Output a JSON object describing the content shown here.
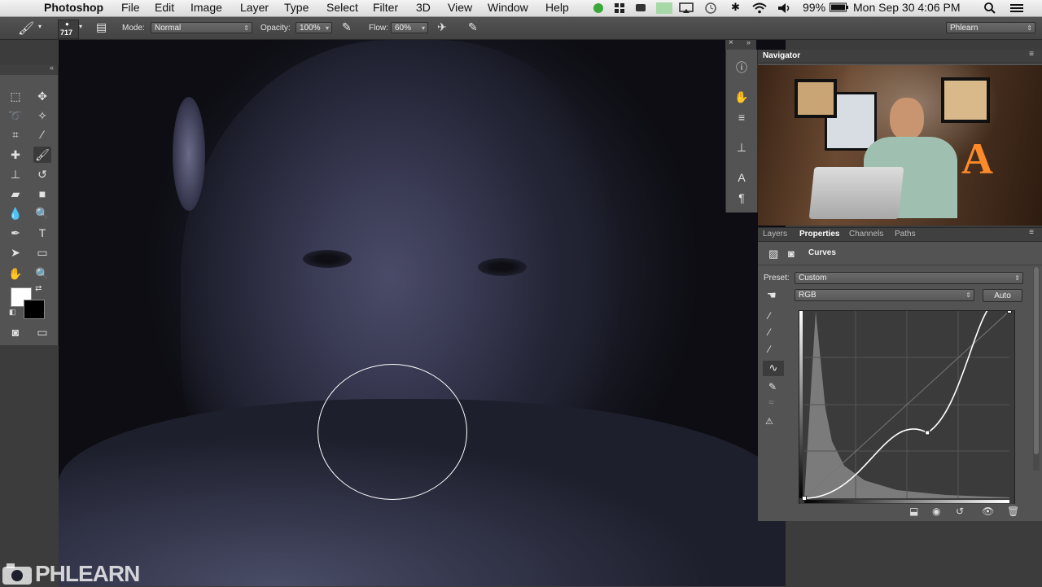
{
  "menubar": {
    "app_name": "Photoshop",
    "menus": [
      "File",
      "Edit",
      "Image",
      "Layer",
      "Type",
      "Select",
      "Filter",
      "3D",
      "View",
      "Window",
      "Help"
    ],
    "battery": "99%",
    "clock": "Mon Sep 30  4:06 PM"
  },
  "options_bar": {
    "brush_size": "717",
    "mode_label": "Mode:",
    "mode_value": "Normal",
    "opacity_label": "Opacity:",
    "opacity_value": "100%",
    "flow_label": "Flow:",
    "flow_value": "60%",
    "workspace": "Phlearn"
  },
  "navigator": {
    "title": "Navigator"
  },
  "properties": {
    "tabs": [
      "Layers",
      "Properties",
      "Channels",
      "Paths"
    ],
    "active_tab": "Properties",
    "adjustment_name": "Curves",
    "preset_label": "Preset:",
    "preset_value": "Custom",
    "channel_value": "RGB",
    "auto_label": "Auto",
    "curve_points": [
      [
        0,
        0
      ],
      [
        0.6,
        0.35
      ],
      [
        1,
        1
      ]
    ]
  },
  "watermark": "PHLEARN",
  "colors": {
    "accent": "#ffffff",
    "panel": "#535353",
    "canvas_dark": "#1a1b26"
  }
}
